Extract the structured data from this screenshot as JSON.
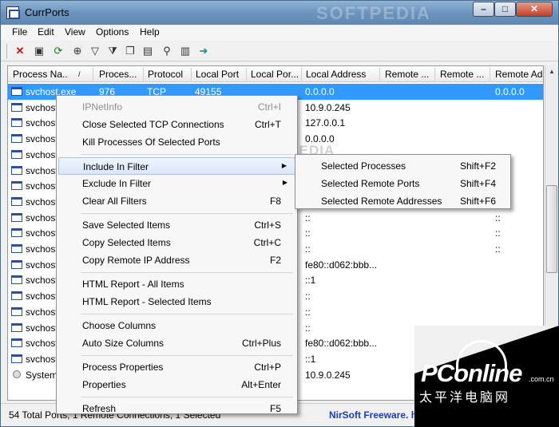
{
  "window": {
    "title": "CurrPorts",
    "watermark": "SOFTPEDIA"
  },
  "menubar": [
    "File",
    "Edit",
    "View",
    "Options",
    "Help"
  ],
  "toolbar_icons": [
    "delete-icon",
    "save-icon",
    "refresh-icon",
    "target-icon",
    "filter-icon",
    "filter-clear-icon",
    "copy-icon",
    "properties-icon",
    "find-icon",
    "report-icon",
    "exit-icon"
  ],
  "columns": [
    "Process Na...",
    "Proces...",
    "Protocol",
    "Local Port",
    "Local Por...",
    "Local Address",
    "Remote ...",
    "Remote ...",
    "Remote Ad"
  ],
  "rows": [
    {
      "name": "svchost.exe",
      "pid": "976",
      "proto": "TCP",
      "lport": "49155",
      "laddr": "0.0.0.0",
      "raddr": "0.0.0.0",
      "sel": true,
      "icon": "window"
    },
    {
      "name": "svchost",
      "laddr": "10.9.0.245",
      "raddr": "",
      "icon": "window"
    },
    {
      "name": "svchost",
      "laddr": "127.0.0.1",
      "raddr": "",
      "icon": "window"
    },
    {
      "name": "svchost",
      "laddr": "0.0.0.0",
      "raddr": "",
      "icon": "window"
    },
    {
      "name": "svchost",
      "laddr": "",
      "raddr": "",
      "icon": "window"
    },
    {
      "name": "svchost",
      "laddr": "",
      "raddr": "",
      "icon": "window"
    },
    {
      "name": "svchost",
      "laddr": "",
      "raddr": "",
      "icon": "window"
    },
    {
      "name": "svchost",
      "laddr": "",
      "raddr": "",
      "icon": "window"
    },
    {
      "name": "svchost",
      "laddr": "::",
      "raddr": "::",
      "icon": "window"
    },
    {
      "name": "svchost",
      "laddr": "::",
      "raddr": "::",
      "icon": "window"
    },
    {
      "name": "svchost",
      "laddr": "::",
      "raddr": "::",
      "icon": "window"
    },
    {
      "name": "svchost",
      "laddr": "fe80::d062:bbb...",
      "raddr": "",
      "icon": "window"
    },
    {
      "name": "svchost",
      "laddr": "::1",
      "raddr": "",
      "icon": "window"
    },
    {
      "name": "svchost",
      "laddr": "::",
      "raddr": "",
      "icon": "window"
    },
    {
      "name": "svchost",
      "laddr": "::",
      "raddr": "",
      "icon": "window"
    },
    {
      "name": "svchost",
      "laddr": "::",
      "raddr": "",
      "icon": "window"
    },
    {
      "name": "svchost",
      "laddr": "fe80::d062:bbb...",
      "raddr": "",
      "icon": "window"
    },
    {
      "name": "svchost",
      "laddr": "::1",
      "raddr": "",
      "icon": "window"
    },
    {
      "name": "System",
      "laddr": "10.9.0.245",
      "raddr": "",
      "icon": "radio"
    }
  ],
  "statusbar": {
    "left": "54 Total Ports, 1 Remote Connections, 1 Selected",
    "right": "NirSoft Freeware.  h"
  },
  "context_menu": [
    {
      "label": "IPNetInfo",
      "key": "Ctrl+I",
      "disabled": true
    },
    {
      "label": "Close Selected TCP Connections",
      "key": "Ctrl+T"
    },
    {
      "label": "Kill Processes Of Selected Ports",
      "key": ""
    },
    {
      "sep": true
    },
    {
      "label": "Include In Filter",
      "key": "",
      "sub": true,
      "hl": true
    },
    {
      "label": "Exclude In Filter",
      "key": "",
      "sub": true
    },
    {
      "label": "Clear All Filters",
      "key": "F8"
    },
    {
      "sep": true
    },
    {
      "label": "Save Selected Items",
      "key": "Ctrl+S"
    },
    {
      "label": "Copy Selected Items",
      "key": "Ctrl+C"
    },
    {
      "label": "Copy Remote IP Address",
      "key": "F2"
    },
    {
      "sep": true
    },
    {
      "label": "HTML Report - All Items",
      "key": ""
    },
    {
      "label": "HTML Report - Selected Items",
      "key": ""
    },
    {
      "sep": true
    },
    {
      "label": "Choose Columns",
      "key": ""
    },
    {
      "label": "Auto Size Columns",
      "key": "Ctrl+Plus"
    },
    {
      "sep": true
    },
    {
      "label": "Process Properties",
      "key": "Ctrl+P"
    },
    {
      "label": "Properties",
      "key": "Alt+Enter"
    },
    {
      "sep": true
    },
    {
      "label": "Refresh",
      "key": "F5"
    }
  ],
  "submenu": [
    {
      "label": "Selected Processes",
      "key": "Shift+F2"
    },
    {
      "label": "Selected Remote Ports",
      "key": "Shift+F4"
    },
    {
      "label": "Selected Remote Addresses",
      "key": "Shift+F6"
    }
  ],
  "overlay": {
    "softpedia": "SOFTPEDIA",
    "pconline": "PConline",
    "pconline_domain": ".com.cn",
    "pconline_cn": "太平洋电脑网"
  }
}
